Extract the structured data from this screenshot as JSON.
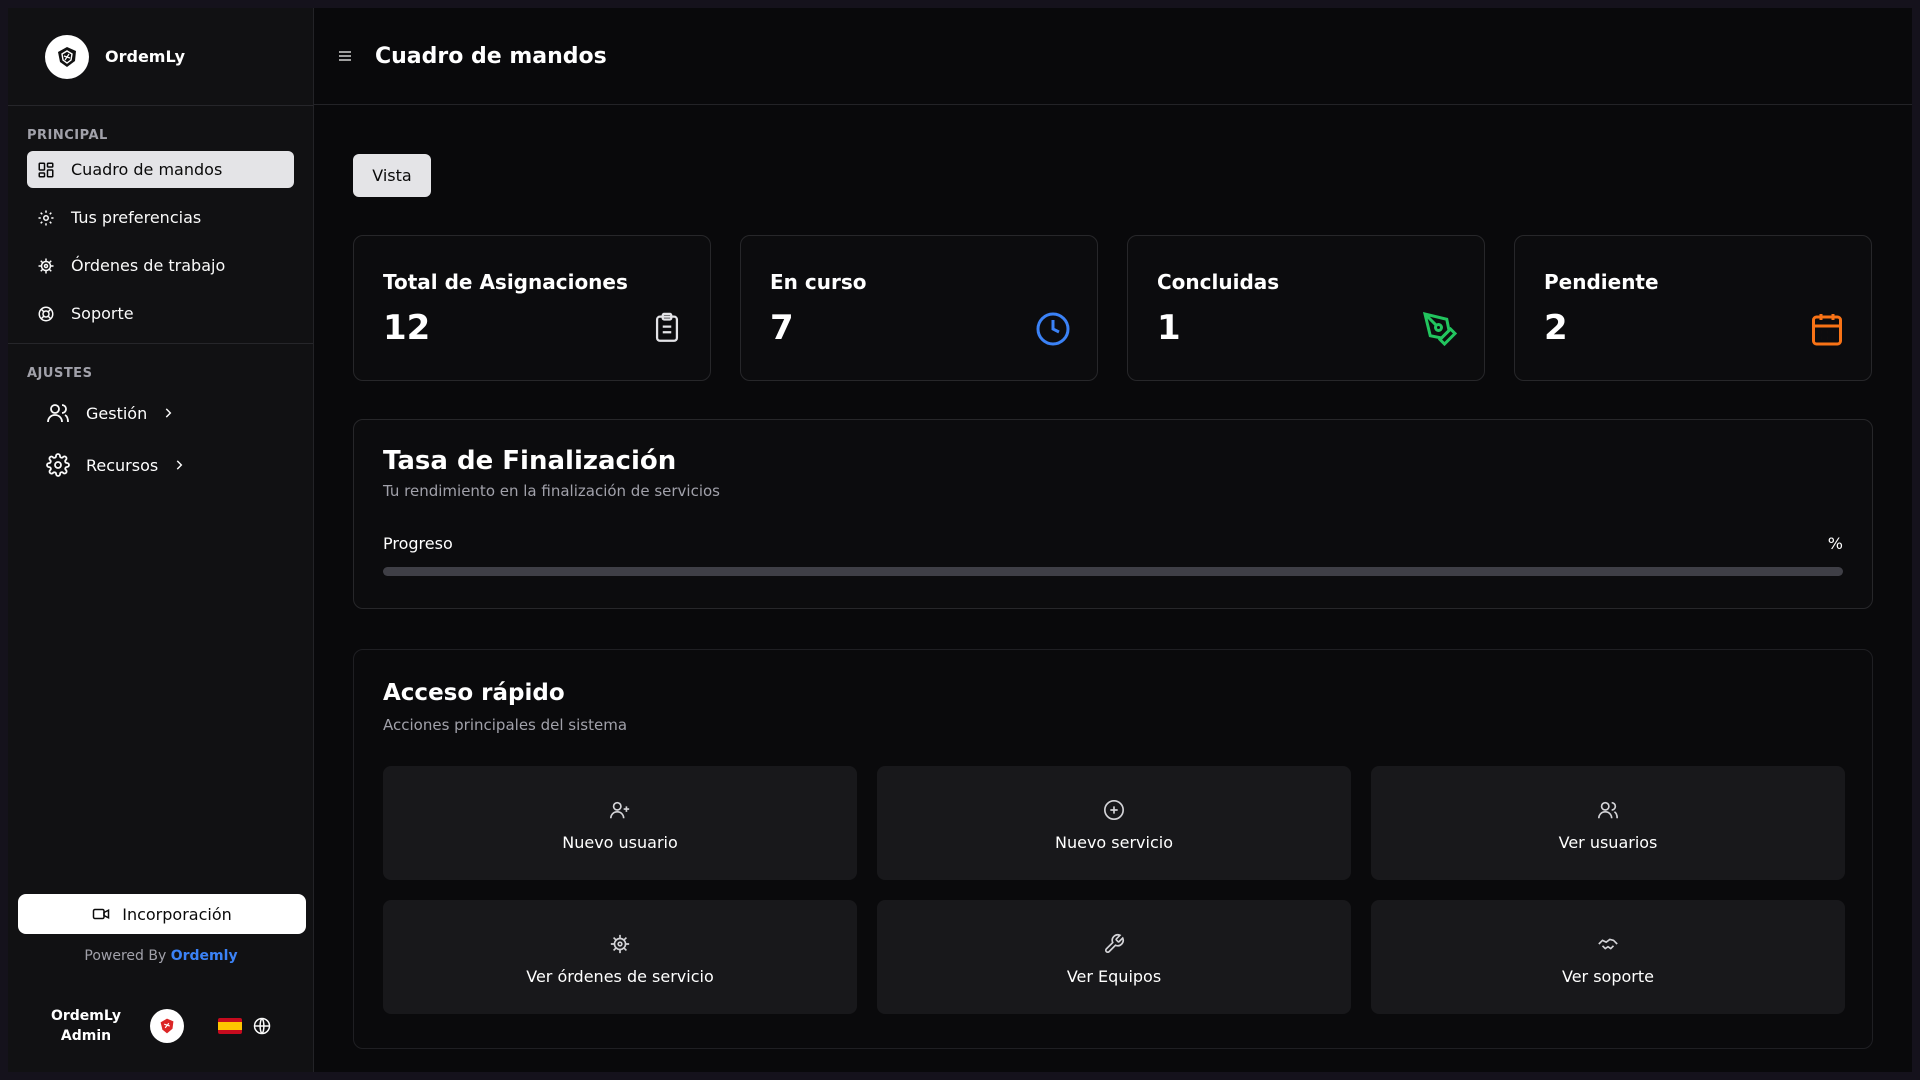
{
  "brand": {
    "name": "OrdemLy"
  },
  "sidebar": {
    "section_principal": "PRINCIPAL",
    "items": [
      {
        "label": "Cuadro de mandos",
        "icon": "dashboard-icon",
        "active": true
      },
      {
        "label": "Tus preferencias",
        "icon": "gear-icon"
      },
      {
        "label": "Órdenes de trabajo",
        "icon": "cog-icon"
      },
      {
        "label": "Soporte",
        "icon": "lifebuoy-icon"
      }
    ],
    "section_ajustes": "AJUSTES",
    "groups": [
      {
        "label": "Gestión",
        "icon": "users-icon"
      },
      {
        "label": "Recursos",
        "icon": "settings-icon"
      }
    ],
    "onboarding_label": "Incorporación",
    "powered_prefix": "Powered By",
    "powered_brand": "Ordemly",
    "user": {
      "name_line1": "OrdemLy",
      "name_line2": "Admin"
    },
    "accent_color": "#3b82f6"
  },
  "header": {
    "title": "Cuadro de mandos"
  },
  "tabs": {
    "vista": "Vista"
  },
  "stats": [
    {
      "title": "Total de Asignaciones",
      "value": "12",
      "icon": "clipboard-icon",
      "color": "#e4e4e7"
    },
    {
      "title": "En curso",
      "value": "7",
      "icon": "clock-icon",
      "color": "#3b82f6"
    },
    {
      "title": "Concluidas",
      "value": "1",
      "icon": "pen-tool-icon",
      "color": "#22c55e"
    },
    {
      "title": "Pendiente",
      "value": "2",
      "icon": "calendar-icon",
      "color": "#f97316"
    }
  ],
  "completion": {
    "title": "Tasa de Finalización",
    "subtitle": "Tu rendimiento en la finalización de servicios",
    "progress_label": "Progreso",
    "percent_label": "%"
  },
  "quick": {
    "title": "Acceso rápido",
    "subtitle": "Acciones principales del sistema",
    "buttons": [
      {
        "label": "Nuevo usuario",
        "icon": "user-plus-icon"
      },
      {
        "label": "Nuevo servicio",
        "icon": "plus-circle-icon"
      },
      {
        "label": "Ver usuarios",
        "icon": "users-icon"
      },
      {
        "label": "Ver órdenes de servicio",
        "icon": "cog-icon"
      },
      {
        "label": "Ver Equipos",
        "icon": "wrench-icon"
      },
      {
        "label": "Ver soporte",
        "icon": "handshake-icon"
      }
    ]
  }
}
